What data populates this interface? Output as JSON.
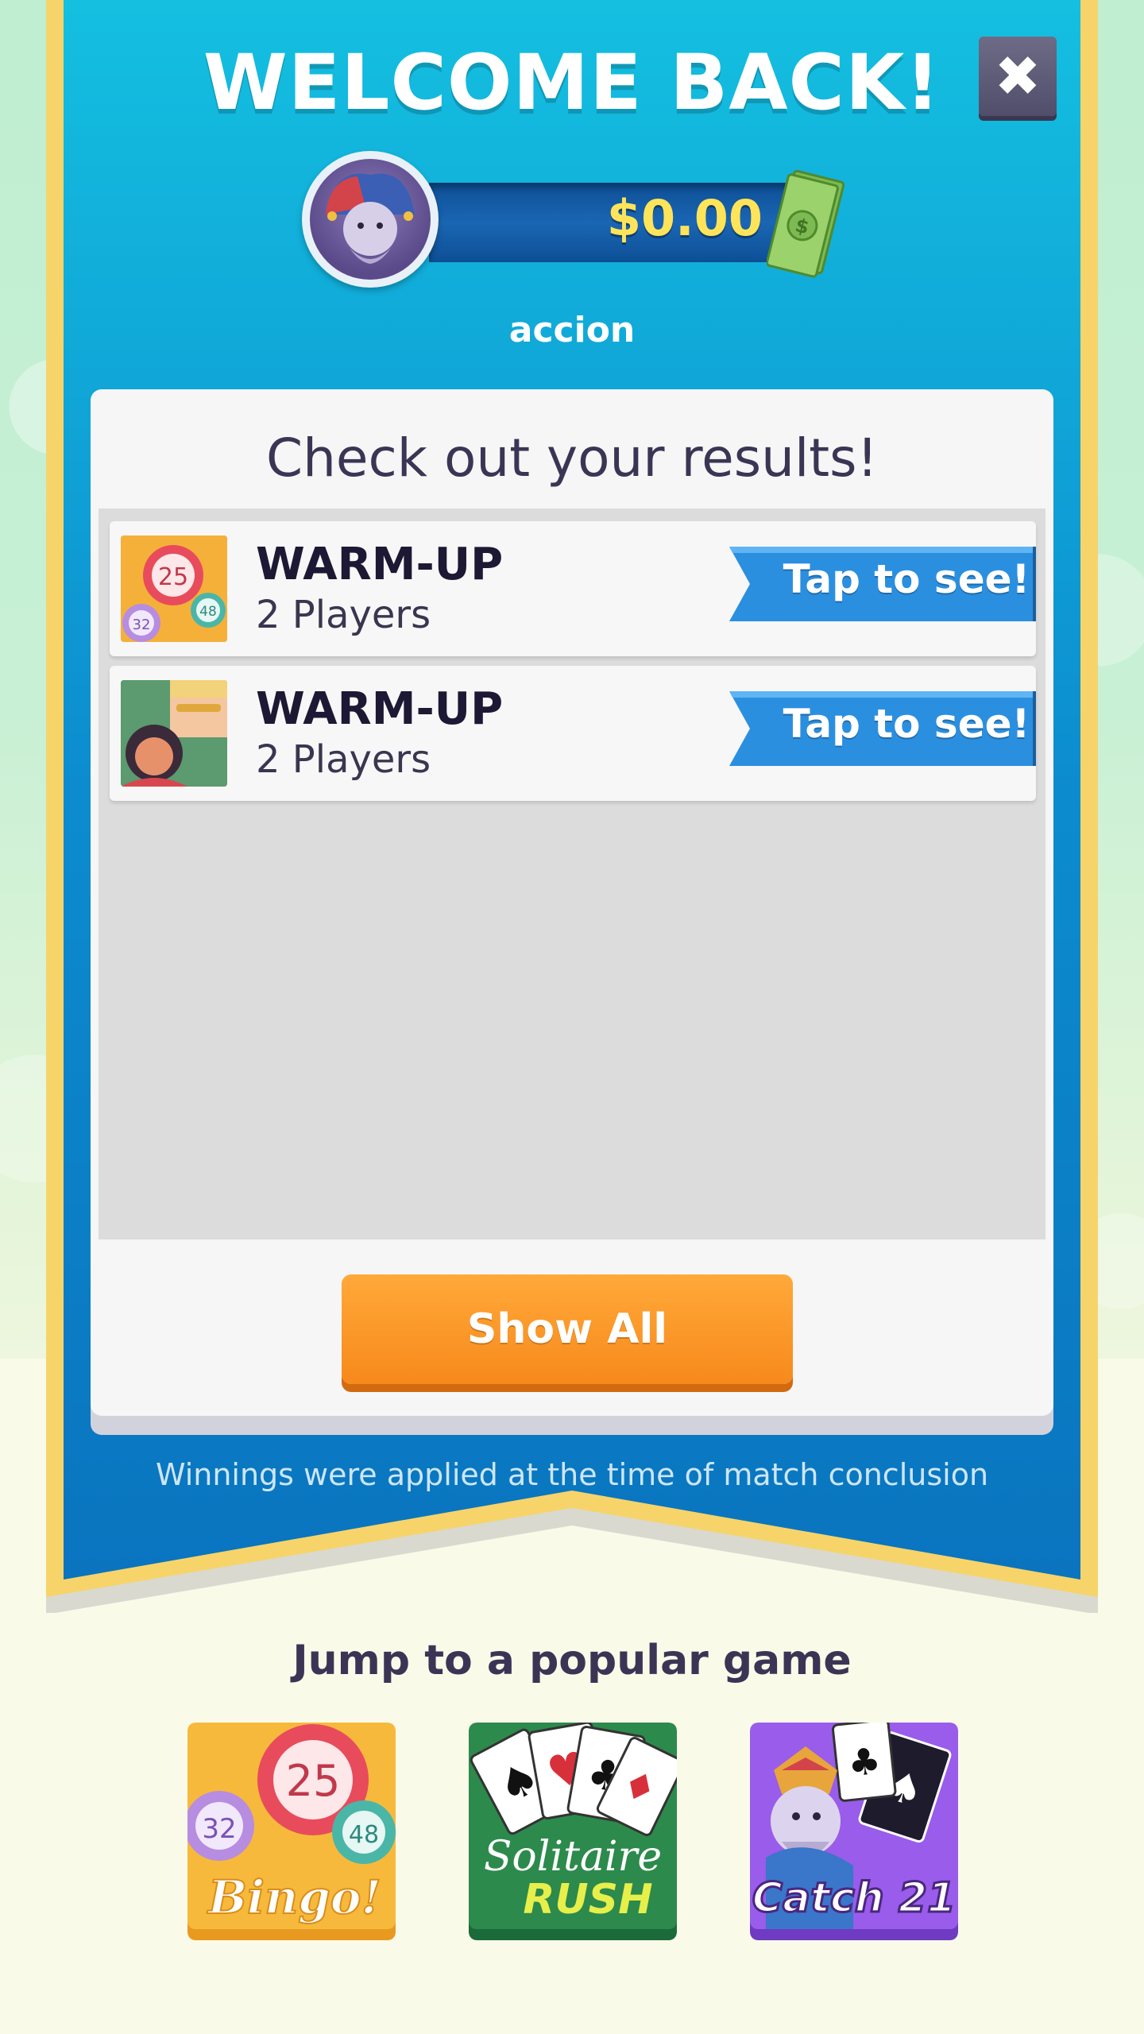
{
  "header": {
    "title": "WELCOME BACK!",
    "close_icon": "close-icon",
    "balance": "$0.00",
    "username": "accion"
  },
  "results": {
    "title": "Check out your results!",
    "rows": [
      {
        "name": "WARM-UP",
        "players": "2 Players",
        "action": "Tap to see!",
        "thumb": "bingo-balls-icon"
      },
      {
        "name": "WARM-UP",
        "players": "2 Players",
        "action": "Tap to see!",
        "thumb": "players-icon"
      }
    ],
    "show_all": "Show All",
    "note": "Winnings were applied at the time of match conclusion"
  },
  "popular": {
    "title": "Jump to a popular game",
    "games": [
      {
        "name": "Bingo!",
        "numbers": [
          "25",
          "32",
          "48"
        ]
      },
      {
        "name": "Solitaire",
        "subtitle": "RUSH"
      },
      {
        "name": "Catch 21"
      }
    ]
  },
  "colors": {
    "banner_blue": "#0f8bd0",
    "banner_border": "#f6d46a",
    "orange": "#f7891b",
    "tap_blue": "#2b8fe0"
  }
}
